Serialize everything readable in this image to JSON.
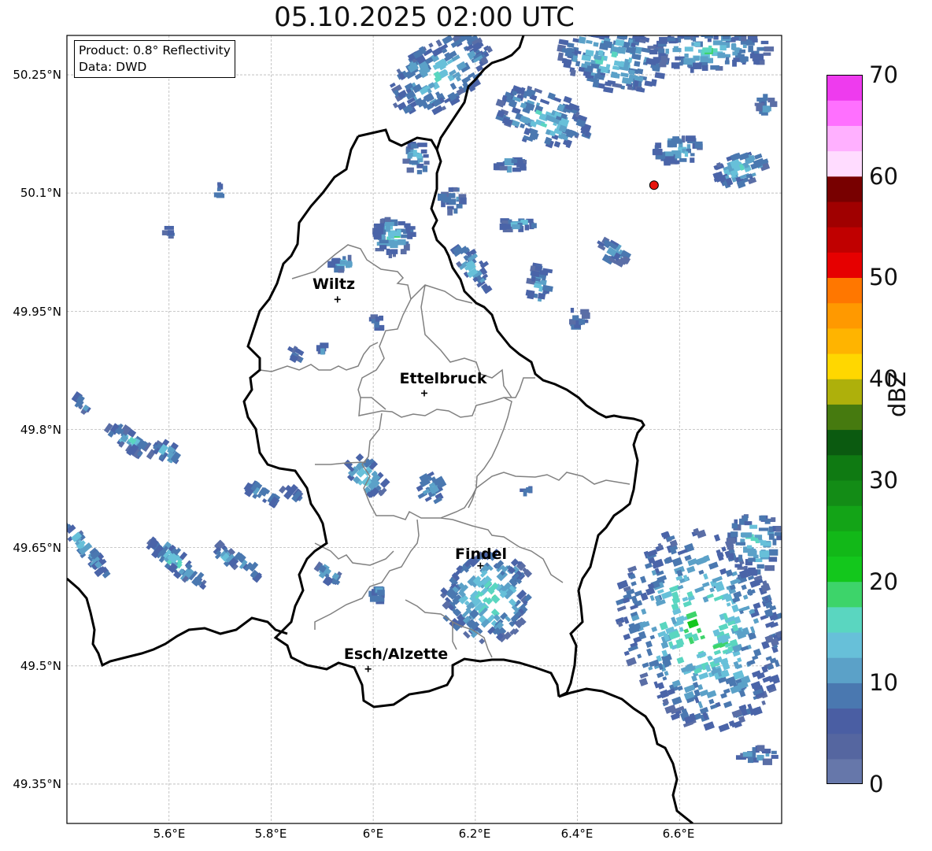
{
  "title": "05.10.2025 02:00 UTC",
  "info": {
    "product": "Product: 0.8° Reflectivity",
    "source": "Data: DWD"
  },
  "lat_labels": [
    "50.25°N",
    "50.1°N",
    "49.95°N",
    "49.8°N",
    "49.65°N",
    "49.5°N",
    "49.35°N"
  ],
  "lon_labels": [
    "5.6°E",
    "5.8°E",
    "6°E",
    "6.2°E",
    "6.4°E",
    "6.6°E"
  ],
  "cities": [
    {
      "name": "Wiltz",
      "lat": 49.965,
      "lon": 5.93
    },
    {
      "name": "Ettelbruck",
      "lat": 49.846,
      "lon": 6.1
    },
    {
      "name": "Findel",
      "lat": 49.627,
      "lon": 6.21
    },
    {
      "name": "Esch/Alzette",
      "lat": 49.496,
      "lon": 5.99
    }
  ],
  "radar_site": {
    "lat": 50.11,
    "lon": 6.55,
    "color": "#e8150e"
  },
  "colorbar": {
    "label": "dBZ",
    "ticks": [
      "0",
      "10",
      "20",
      "30",
      "40",
      "50",
      "60",
      "70"
    ],
    "vmin": 0,
    "vmax": 70,
    "step": 2.5,
    "colors": [
      "#6677aa",
      "#5566a0",
      "#4a5ea3",
      "#4a78b0",
      "#5ba1c8",
      "#67c0d9",
      "#5ad6c0",
      "#3dd46a",
      "#13c71c",
      "#12b818",
      "#13a417",
      "#138c16",
      "#0f7a12",
      "#0b5a10",
      "#467a0f",
      "#aeb00b",
      "#ffd700",
      "#ffb400",
      "#ff9900",
      "#ff7700",
      "#e60000",
      "#c00000",
      "#a00000",
      "#780000",
      "#ffdcff",
      "#ffb0ff",
      "#ff70ff",
      "#ee3bee"
    ]
  }
}
